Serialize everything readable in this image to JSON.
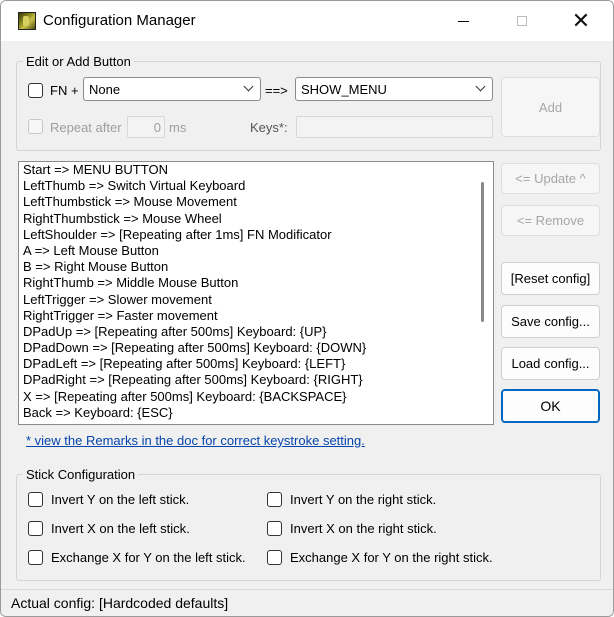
{
  "window": {
    "title": "Configuration Manager"
  },
  "edit_group": {
    "legend": "Edit or Add Button",
    "fn_label": "FN +",
    "fn_combo_value": "None",
    "arrow": "==>",
    "action_combo_value": "SHOW_MENU",
    "add_label": "Add",
    "repeat_label": "Repeat after",
    "repeat_value": "0",
    "repeat_unit": "ms",
    "keys_label": "Keys*:"
  },
  "mappings": [
    "Start => MENU BUTTON",
    "LeftThumb => Switch Virtual Keyboard",
    "LeftThumbstick => Mouse Movement",
    "RightThumbstick => Mouse Wheel",
    "LeftShoulder => [Repeating after 1ms] FN Modificator",
    "A => Left Mouse Button",
    "B => Right Mouse Button",
    "RightThumb => Middle Mouse Button",
    "LeftTrigger => Slower movement",
    "RightTrigger => Faster movement",
    "DPadUp => [Repeating after 500ms] Keyboard: {UP}",
    "DPadDown => [Repeating after 500ms] Keyboard: {DOWN}",
    "DPadLeft => [Repeating after 500ms] Keyboard: {LEFT}",
    "DPadRight => [Repeating after 500ms] Keyboard: {RIGHT}",
    "X => [Repeating after 500ms] Keyboard: {BACKSPACE}",
    "Back => Keyboard: {ESC}"
  ],
  "side_buttons": {
    "update": "<= Update ^",
    "remove": "<= Remove",
    "reset": "[Reset config]",
    "save": "Save config...",
    "load": "Load config...",
    "ok": "OK"
  },
  "remarks_link": "* view the Remarks in the doc for correct keystroke setting.",
  "stick_group": {
    "legend": "Stick Configuration",
    "invert_y_left": "Invert Y on the left stick.",
    "invert_x_left": "Invert X on the left stick.",
    "exchange_left": "Exchange X for Y on the left stick.",
    "invert_y_right": "Invert Y on the right stick.",
    "invert_x_right": "Invert X on the right stick.",
    "exchange_right": "Exchange X for Y on the right stick."
  },
  "status": {
    "text": "Actual config: [Hardcoded defaults]"
  }
}
